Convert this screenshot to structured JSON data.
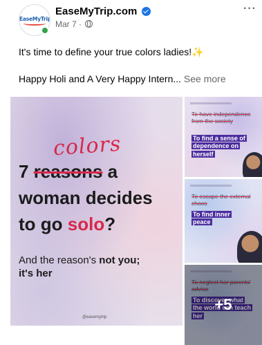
{
  "post": {
    "page_name": "EaseMyTrip.com",
    "date": "Mar 7 ·",
    "avatar_logo_text": "EaseMyTrip",
    "caption_line1": "It's time to define your true colors ladies!",
    "caption_sparkle": "✨",
    "caption_line2": "Happy Holi and A Very Happy Intern...",
    "see_more": "See more",
    "more_menu": "···"
  },
  "main_image": {
    "colors_word": "colors",
    "line1_num": "7 ",
    "line1_strike": "reasons",
    "line1_end": " a",
    "line2": "woman decides",
    "line3_start": "to go ",
    "line3_solo": "solo",
    "line3_end": "?",
    "sub_start": "And the reason's ",
    "sub_bold": "not you;",
    "sub_line2": "it's her",
    "handle": "@easemytrip"
  },
  "thumbs": [
    {
      "strike": "To have independence from the society",
      "highlight": "To find a sense of dependence on herself"
    },
    {
      "strike": "To escape the external chaos",
      "highlight": "To find inner peace"
    },
    {
      "strike": "To neglect her parents' advise",
      "highlight": "To discover what the world can teach her"
    }
  ],
  "more_count": "+5",
  "colors": {
    "accent_red": "#d8284a",
    "highlight_purple": "#4b2d9e",
    "fb_blue": "#1b74e4",
    "online_green": "#31a24c"
  }
}
